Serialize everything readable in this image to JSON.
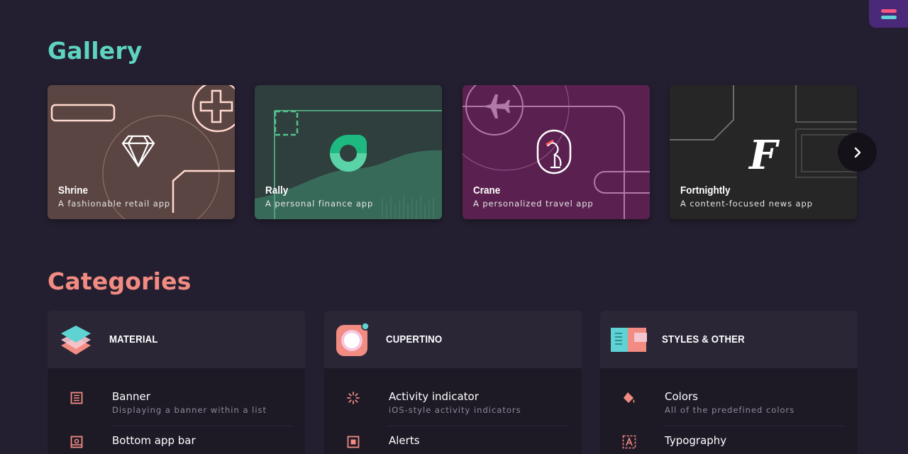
{
  "gallery": {
    "title": "Gallery",
    "cards": [
      {
        "name": "Shrine",
        "description": "A fashionable retail app"
      },
      {
        "name": "Rally",
        "description": "A personal finance app"
      },
      {
        "name": "Crane",
        "description": "A personalized travel app"
      },
      {
        "name": "Fortnightly",
        "description": "A content-focused news app"
      }
    ],
    "next_icon": "chevron-right-icon"
  },
  "categories": {
    "title": "Categories",
    "groups": [
      {
        "label": "MATERIAL",
        "icon": "material-layers-icon",
        "items": [
          {
            "title": "Banner",
            "subtitle": "Displaying a banner within a list",
            "icon": "banner-icon"
          },
          {
            "title": "Bottom app bar",
            "subtitle": "",
            "icon": "bottom-app-bar-icon"
          }
        ]
      },
      {
        "label": "CUPERTINO",
        "icon": "cupertino-icon",
        "items": [
          {
            "title": "Activity indicator",
            "subtitle": "iOS-style activity indicators",
            "icon": "activity-indicator-icon"
          },
          {
            "title": "Alerts",
            "subtitle": "",
            "icon": "alerts-icon"
          }
        ]
      },
      {
        "label": "STYLES & OTHER",
        "icon": "styles-icon",
        "items": [
          {
            "title": "Colors",
            "subtitle": "All of the predefined colors",
            "icon": "paint-bucket-icon"
          },
          {
            "title": "Typography",
            "subtitle": "",
            "icon": "typography-icon"
          }
        ]
      }
    ]
  },
  "settings": {
    "icon": "settings-icon"
  },
  "colors": {
    "background": "#241f30",
    "gallery_title": "#5dd3c0",
    "categories_title": "#f28b82",
    "accent_pink": "#f28b82",
    "shrine": "#5b4542",
    "rally": "#2e3f3d",
    "crane": "#5a2150",
    "fortnightly": "#262626"
  }
}
